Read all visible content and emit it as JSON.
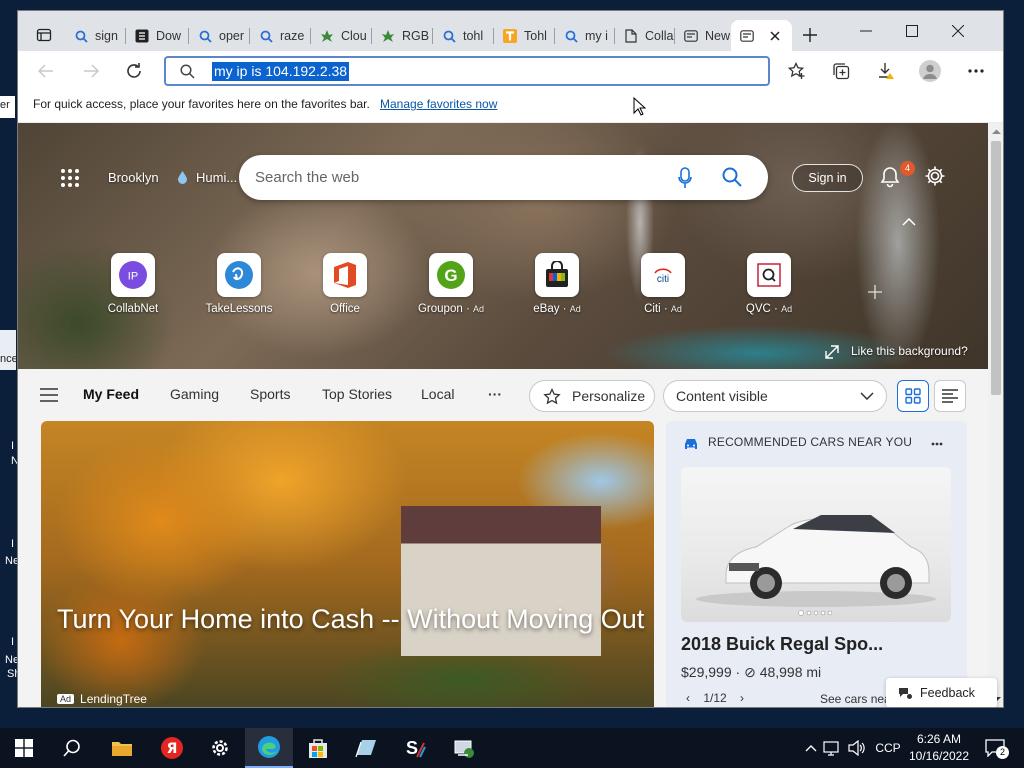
{
  "desktop": {
    "fragments": [
      "er",
      "nce"
    ],
    "icon_labels": [
      "I",
      "N",
      "I",
      "Ne",
      "I",
      "Ne",
      "Sh"
    ]
  },
  "tabs": [
    {
      "label": "sign",
      "icon": "search-icon"
    },
    {
      "label": "Dow",
      "icon": "app-icon"
    },
    {
      "label": "oper",
      "icon": "search-icon"
    },
    {
      "label": "raze",
      "icon": "search-icon"
    },
    {
      "label": "Clou",
      "icon": "leaf-icon"
    },
    {
      "label": "RGB",
      "icon": "leaf-icon"
    },
    {
      "label": "tohl",
      "icon": "search-icon"
    },
    {
      "label": "Tohl",
      "icon": "t-logo-icon"
    },
    {
      "label": "my i",
      "icon": "search-icon"
    },
    {
      "label": "Colla",
      "icon": "page-icon"
    },
    {
      "label": "New",
      "icon": "newtab-icon"
    }
  ],
  "address_bar": {
    "value": "my ip is 104.192.2.38"
  },
  "favorites_bar": {
    "text": "For quick access, place your favorites here on the favorites bar.",
    "link": "Manage favorites now"
  },
  "header": {
    "location": "Brooklyn",
    "weather": "Humi...",
    "search_placeholder": "Search the web",
    "sign_in": "Sign in",
    "notification_count": "4"
  },
  "top_sites": [
    {
      "label": "CollabNet",
      "ad": "",
      "icon": "collabnet-icon"
    },
    {
      "label": "TakeLessons",
      "ad": "",
      "icon": "takelessons-icon"
    },
    {
      "label": "Office",
      "ad": "",
      "icon": "office-icon"
    },
    {
      "label": "Groupon",
      "ad": "Ad",
      "icon": "groupon-icon"
    },
    {
      "label": "eBay",
      "ad": "Ad",
      "icon": "ebay-icon"
    },
    {
      "label": "Citi",
      "ad": "Ad",
      "icon": "citi-icon"
    },
    {
      "label": "QVC",
      "ad": "Ad",
      "icon": "qvc-icon"
    }
  ],
  "like_background": "Like this background?",
  "feed_nav": {
    "items": [
      "My Feed",
      "Gaming",
      "Sports",
      "Top Stories",
      "Local"
    ],
    "more": "···",
    "personalize": "Personalize",
    "content_select": "Content visible"
  },
  "article": {
    "headline": "Turn Your Home into Cash -- Without Moving Out",
    "ad_tag": "Ad",
    "source": "LendingTree"
  },
  "car_card": {
    "header": "RECOMMENDED CARS NEAR YOU",
    "title": "2018 Buick Regal Spo...",
    "price": "$29,999",
    "mileage": "48,998 mi",
    "pager": "1/12",
    "see_cars": "See cars nea"
  },
  "feedback": "Feedback",
  "taskbar": {
    "input_indicator": "CCP",
    "time": "6:26 AM",
    "date": "10/16/2022",
    "notification_count": "2"
  }
}
